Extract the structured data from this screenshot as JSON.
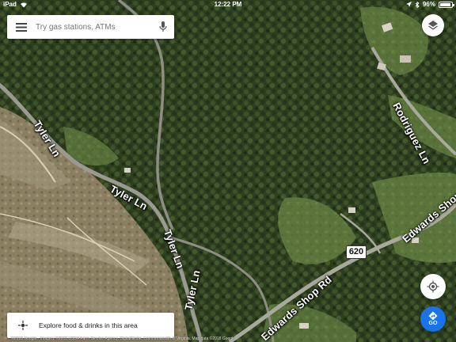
{
  "status_bar": {
    "device": "iPad",
    "time": "12:22 PM",
    "battery_text": "96%",
    "battery_level": 0.96
  },
  "search": {
    "placeholder": "Try gas stations, ATMs",
    "menu_icon": "hamburger-menu-icon",
    "mic_icon": "microphone-icon"
  },
  "layers": {
    "icon": "layers-icon"
  },
  "map": {
    "type": "satellite",
    "roads": [
      "Tyler Ln",
      "Tyler Ln",
      "Tyler Ln",
      "Tyler Ln",
      "Edwards Shop Rd",
      "Edwards Shop Rd",
      "Rodriguez Ln"
    ],
    "route_shield": "620"
  },
  "explore": {
    "icon": "explore-sparkle-icon",
    "label": "Explore food & drinks in this area"
  },
  "location_button": {
    "icon": "my-location-icon"
  },
  "go_button": {
    "icon": "directions-icon",
    "label": "GO"
  },
  "attribution": "©2018 Google · Imagery ©2018 USDA Farm Service Agency, DigitalGlobe, Commonwealth of Virginia, Map data ©2018 Google"
}
